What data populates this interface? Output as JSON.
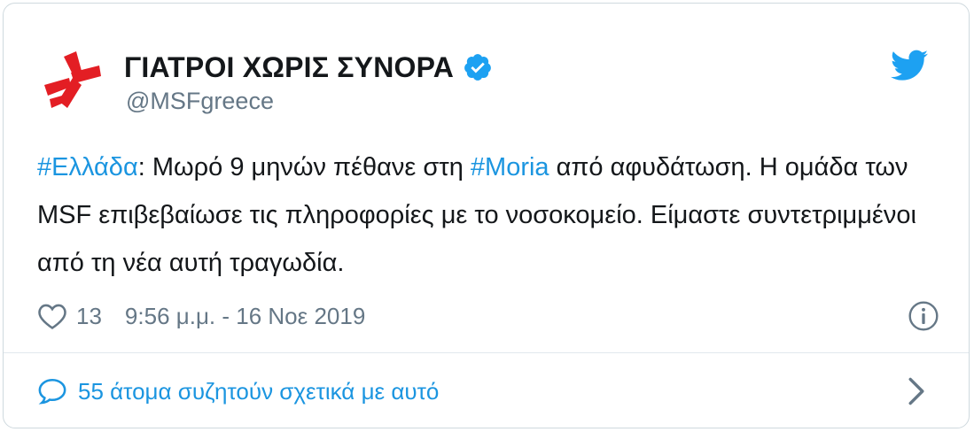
{
  "author": {
    "display_name": "ΓΙΑΤΡΟΙ ΧΩΡΙΣ ΣΥΝΟΡΑ",
    "handle": "@MSFgreece",
    "avatar_icon": "msf-logo-icon",
    "verified_icon": "verified-badge-icon"
  },
  "platform_icon": "twitter-bird-icon",
  "tweet": {
    "segments": [
      {
        "text": "#Ελλάδα",
        "type": "hashtag"
      },
      {
        "text": ": Μωρό 9 μηνών πέθανε στη ",
        "type": "text"
      },
      {
        "text": "#Moria",
        "type": "hashtag"
      },
      {
        "text": " από αφυδάτωση. Η ομάδα των MSF επιβεβαίωσε τις πληροφορίες με το νοσοκομείο. Είμαστε συντετριμμένοι από τη νέα αυτή τραγωδία.",
        "type": "text"
      }
    ]
  },
  "meta": {
    "like_count": "13",
    "timestamp": "9:56 μ.μ. - 16 Νοε 2019"
  },
  "conversation": {
    "label": "55 άτομα συζητούν σχετικά με αυτό"
  },
  "colors": {
    "brand_red": "#e31e24",
    "link_blue": "#1b95e0",
    "verified_blue": "#1da1f2",
    "text": "#14171a",
    "muted": "#657786"
  }
}
